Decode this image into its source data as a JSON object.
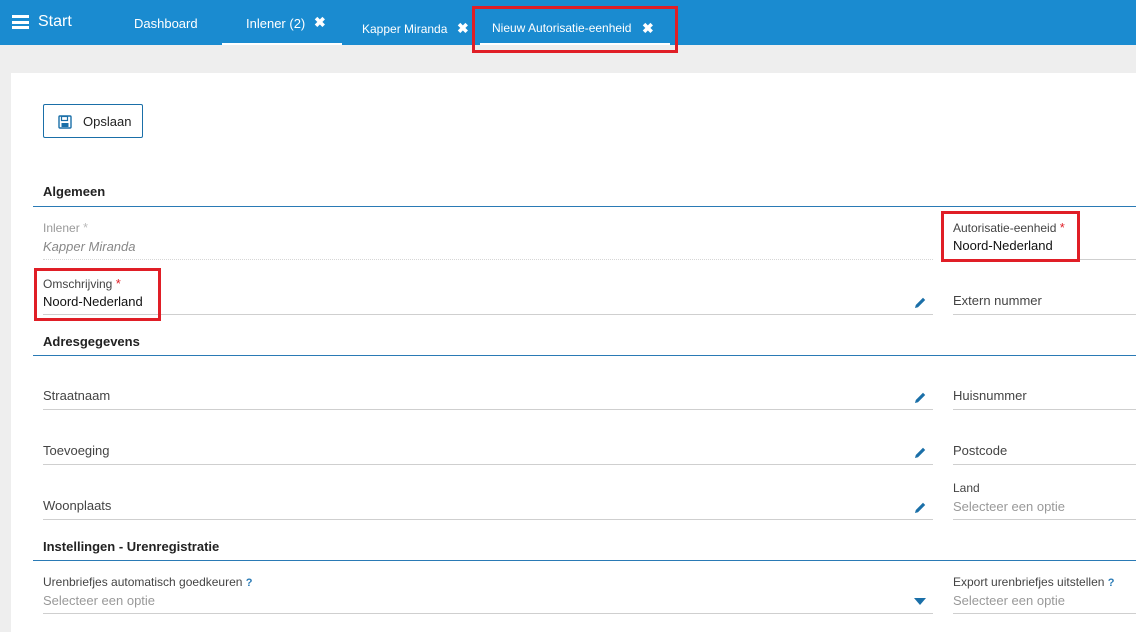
{
  "topbar": {
    "start_label": "Start",
    "tabs": [
      {
        "label": "Dashboard"
      },
      {
        "label": "Inlener (2)"
      },
      {
        "label": "Kapper Miranda"
      },
      {
        "label": "Nieuw Autorisatie-eenheid"
      }
    ],
    "close_glyph": "✖"
  },
  "toolbar": {
    "save_label": "Opslaan"
  },
  "sections": {
    "algemeen": "Algemeen",
    "adres": "Adresgegevens",
    "instellingen": "Instellingen - Urenregistratie"
  },
  "fields": {
    "inlener": {
      "label": "Inlener",
      "value": "Kapper Miranda"
    },
    "autorisatie": {
      "label": "Autorisatie-eenheid",
      "value": "Noord-Nederland"
    },
    "omschrijving": {
      "label": "Omschrijving",
      "value": "Noord-Nederland"
    },
    "extern": {
      "label": "Extern nummer"
    },
    "straatnaam": {
      "label": "Straatnaam"
    },
    "huisnummer": {
      "label": "Huisnummer"
    },
    "toevoeging": {
      "label": "Toevoeging"
    },
    "postcode": {
      "label": "Postcode"
    },
    "woonplaats": {
      "label": "Woonplaats"
    },
    "land": {
      "label": "Land",
      "placeholder": "Selecteer een optie"
    },
    "urenbriefjes": {
      "label": "Urenbriefjes automatisch goedkeuren",
      "placeholder": "Selecteer een optie"
    },
    "export": {
      "label": "Export urenbriefjes uitstellen",
      "placeholder": "Selecteer een optie"
    }
  },
  "required_mark": "*",
  "help_mark": "?",
  "colors": {
    "brand": "#1a8bd0",
    "highlight": "#e01e26",
    "accent": "#2a7ab5"
  }
}
